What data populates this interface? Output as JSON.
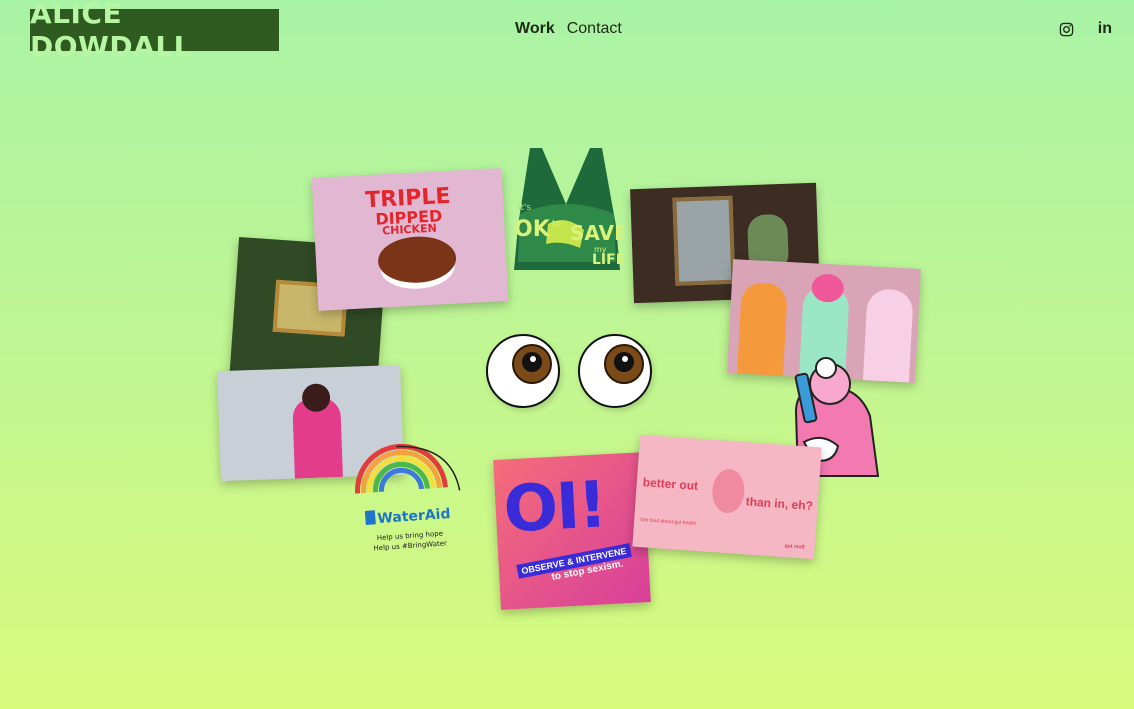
{
  "header": {
    "logo": "ALICE DOWDALL",
    "nav": [
      {
        "label": "Work",
        "active": true
      },
      {
        "label": "Contact",
        "active": false
      }
    ],
    "social": [
      {
        "icon": "instagram-icon"
      },
      {
        "icon": "linkedin-icon",
        "label": "in"
      }
    ]
  },
  "tiles": {
    "chicken": {
      "line1": "TRIPLE",
      "line2": "DIPPED",
      "line3": "CHICKEN"
    },
    "bra": {
      "line1": "it's",
      "line2": "OK",
      "line3": "to",
      "line4": "SAVE",
      "line5": "my",
      "line6": "LIFE"
    },
    "wateraid": {
      "brand": "WaterAid",
      "tagline1": "Help us bring hope",
      "tagline2": "Help us #BringWater"
    },
    "oi": {
      "big": "OI!",
      "band1": "OBSERVE",
      "amp": "&",
      "band2": "INTERVENE",
      "small": "to stop sexism."
    },
    "better": {
      "left": "better out",
      "right": "than in, eh?",
      "tiny": "Get loud about gut health",
      "tag": "gut stuff"
    }
  },
  "colors": {
    "background_top": "#a9f3a6",
    "background_bottom": "#d8fb7c",
    "logo_bg": "#2f5a20",
    "logo_text": "#b7f7a4"
  }
}
